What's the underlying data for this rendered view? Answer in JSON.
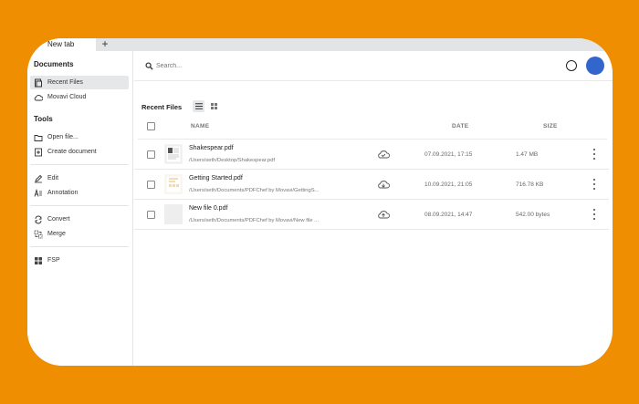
{
  "tab": {
    "title": "New tab",
    "add_label": "+"
  },
  "sidebar": {
    "documents_title": "Documents",
    "documents_items": [
      {
        "label": "Recent Files",
        "icon": "recent-files-icon",
        "active": true
      },
      {
        "label": "Movavi Cloud",
        "icon": "cloud-icon",
        "active": false
      }
    ],
    "tools_title": "Tools",
    "tools_items": [
      {
        "label": "Open file...",
        "icon": "folder-icon"
      },
      {
        "label": "Create document",
        "icon": "create-document-icon"
      },
      {
        "label": "Edit",
        "icon": "edit-icon"
      },
      {
        "label": "Annotation",
        "icon": "annotation-icon"
      },
      {
        "label": "Convert",
        "icon": "convert-icon"
      },
      {
        "label": "Merge",
        "icon": "merge-icon"
      },
      {
        "label": "FSP",
        "icon": "grid-icon"
      }
    ]
  },
  "search": {
    "placeholder": "Search..."
  },
  "main": {
    "recent_title": "Recent Files",
    "columns": {
      "name": "NAME",
      "date": "DATE",
      "size": "SIZE"
    },
    "files": [
      {
        "name": "Shakespear.pdf",
        "path": "/Users/seth/Desktop/Shakespear.pdf",
        "cloud": "cloud-synced-icon",
        "date": "07.09.2021, 17:15",
        "size": "1.47 MB"
      },
      {
        "name": "Getting Started.pdf",
        "path": "/Users/seth/Documents/PDFChef by Movavi/GettingS...",
        "cloud": "cloud-download-icon",
        "date": "10.09.2021, 21:05",
        "size": "716.78 KB"
      },
      {
        "name": "New file 0.pdf",
        "path": "/Users/seth/Documents/PDFChef by Movavi/New file ...",
        "cloud": "cloud-upload-icon",
        "date": "08.09.2021, 14:47",
        "size": "542.00 bytes"
      }
    ]
  },
  "colors": {
    "background": "#ee8e00",
    "avatar": "#3366cc",
    "active_item": "#e6e7e9"
  }
}
